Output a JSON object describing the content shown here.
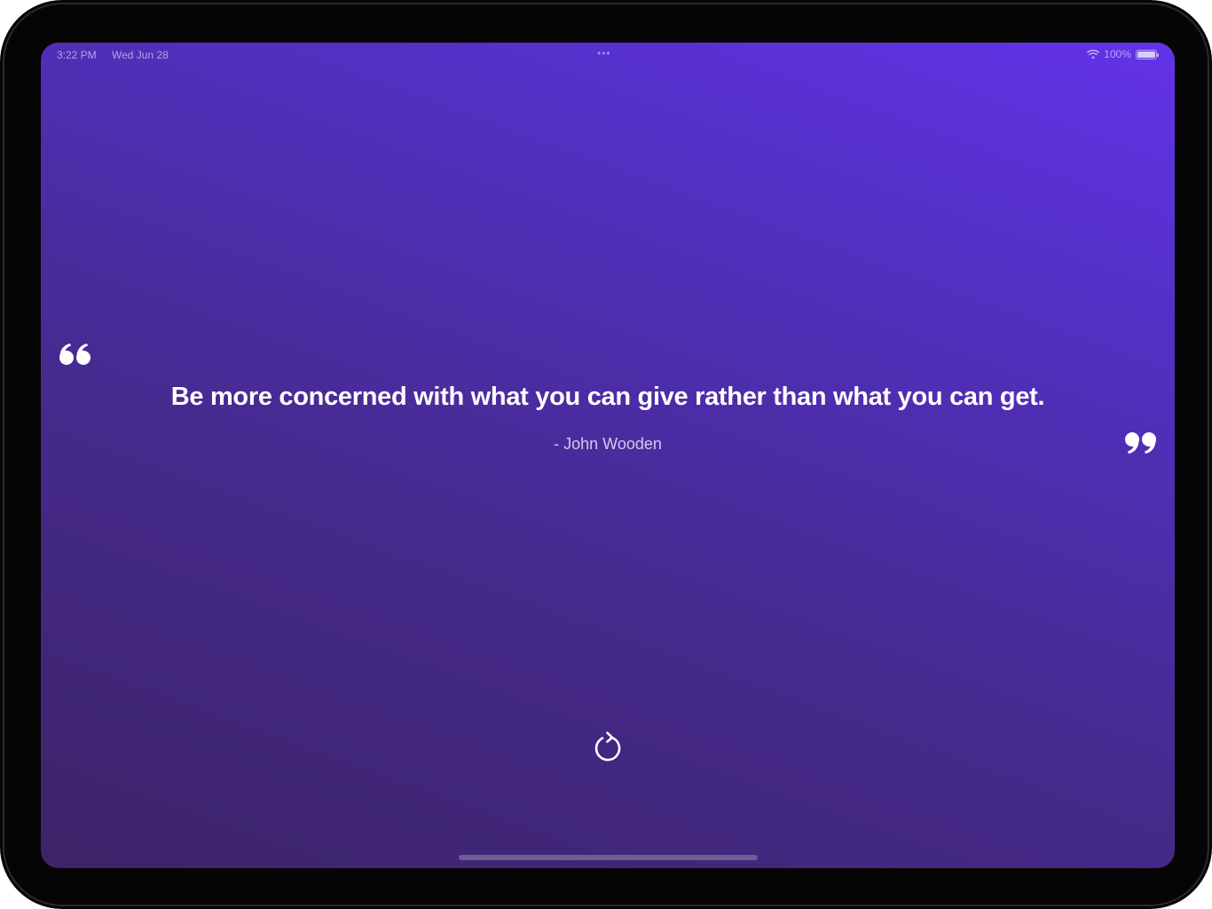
{
  "status_bar": {
    "time": "3:22 PM",
    "date": "Wed Jun 28",
    "multitask_dots": "•••",
    "battery_percent": "100%",
    "battery_level": 1.0
  },
  "quote": {
    "text": "Be more concerned with what you can give rather than what you can get.",
    "author": "- John Wooden"
  },
  "icons": {
    "open_quote": "open-quote-icon",
    "close_quote": "close-quote-icon",
    "refresh": "refresh-icon",
    "wifi": "wifi-icon",
    "battery": "battery-icon"
  },
  "colors": {
    "gradient_start": "#3d2468",
    "gradient_end": "#6333e8",
    "text": "#ffffff"
  }
}
